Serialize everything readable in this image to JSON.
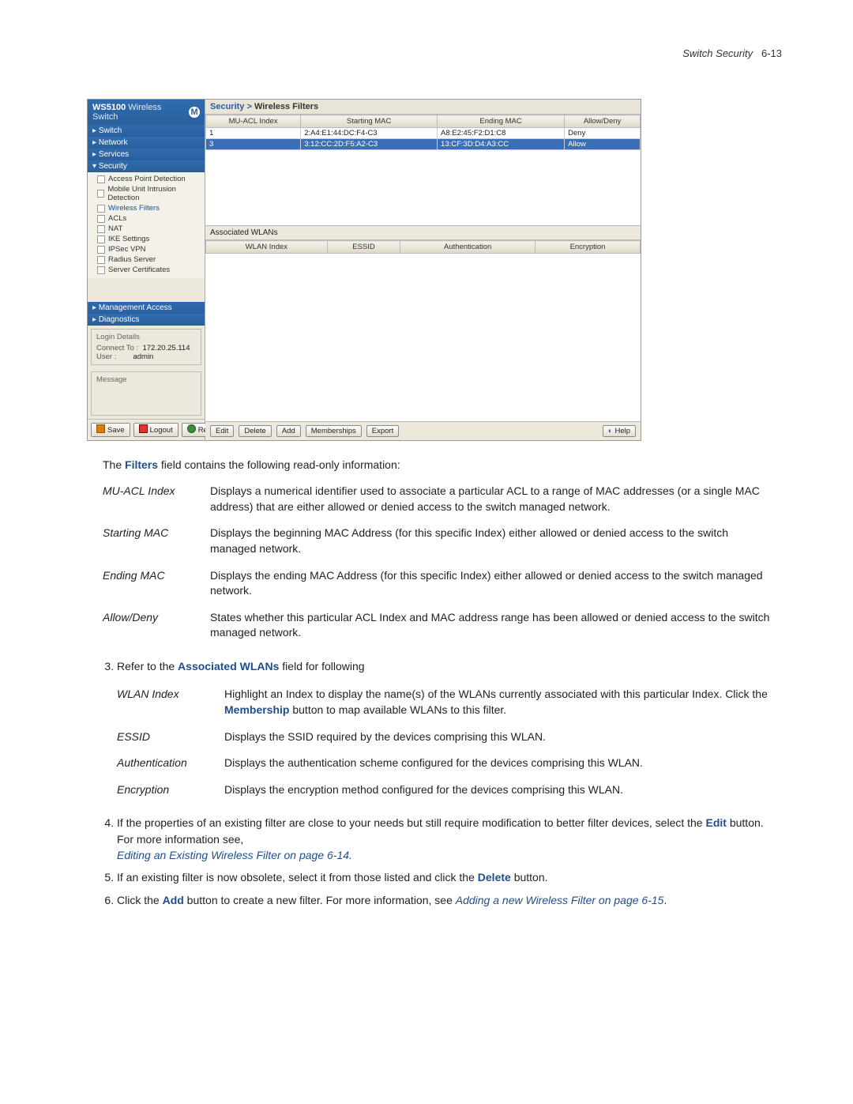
{
  "page_header": {
    "title_italic": "Switch Security",
    "page_no": "6-13"
  },
  "app": {
    "brand": "WS5100",
    "brand_sub": "Wireless Switch",
    "breadcrumb_prefix": "Security >",
    "breadcrumb_current": "Wireless Filters",
    "nav": {
      "switch": "Switch",
      "network": "Network",
      "services": "Services",
      "security": "Security",
      "items": [
        "Access Point Detection",
        "Mobile Unit Intrusion Detection",
        "Wireless Filters",
        "ACLs",
        "NAT",
        "IKE Settings",
        "IPSec VPN",
        "Radius Server",
        "Server Certificates"
      ],
      "mgmt": "Management Access",
      "diag": "Diagnostics"
    },
    "login": {
      "title": "Login Details",
      "connect_lbl": "Connect To :",
      "connect_val": "172.20.25.114",
      "user_lbl": "User :",
      "user_val": "admin"
    },
    "message_title": "Message",
    "sidebar_buttons": {
      "save": "Save",
      "logout": "Logout",
      "refresh": "Refresh"
    },
    "filters_table": {
      "headers": [
        "MU-ACL Index",
        "Starting MAC",
        "Ending MAC",
        "Allow/Deny"
      ],
      "rows": [
        {
          "idx": "1",
          "start": "2:A4:E1:44:DC:F4-C3",
          "end": "A8:E2:45:F2:D1:C8",
          "ad": "Deny",
          "selected": false
        },
        {
          "idx": "3",
          "start": "3:12:CC:2D:F5:A2-C3",
          "end": "13:CF:3D:D4:A3:CC",
          "ad": "Allow",
          "selected": true
        }
      ]
    },
    "assoc_label": "Associated WLANs",
    "assoc_headers": [
      "WLAN Index",
      "ESSID",
      "Authentication",
      "Encryption"
    ],
    "main_buttons": {
      "edit": "Edit",
      "delete": "Delete",
      "add": "Add",
      "memberships": "Memberships",
      "export": "Export",
      "help": "Help"
    }
  },
  "doc": {
    "intro_pre": "The ",
    "intro_bold": "Filters",
    "intro_post": " field contains the following read-only information:",
    "filters_defs": [
      {
        "term": "MU-ACL Index",
        "def": "Displays a numerical identifier used to associate a particular ACL to a range of MAC addresses (or a single MAC address) that are either allowed or denied access to the switch managed network."
      },
      {
        "term": "Starting MAC",
        "def": "Displays the beginning MAC Address (for this specific Index) either allowed or denied access to the switch managed network."
      },
      {
        "term": "Ending MAC",
        "def": "Displays the ending MAC Address (for this specific Index) either allowed or denied access to the switch managed network."
      },
      {
        "term": "Allow/Deny",
        "def": "States whether this particular ACL Index and MAC address range has been allowed or denied access to the switch managed network."
      }
    ],
    "step3": {
      "pre": "Refer to the ",
      "bold": "Associated WLANs",
      "post": " field for following"
    },
    "wlan_defs": [
      {
        "term": "WLAN Index",
        "def_pre": "Highlight an Index to display the name(s) of the WLANs currently associated with this particular Index. Click the ",
        "def_bold": "Membership",
        "def_post": " button to map available WLANs to this filter."
      },
      {
        "term": "ESSID",
        "def": "Displays the SSID required by the devices comprising this WLAN."
      },
      {
        "term": "Authentication",
        "def": "Displays the authentication scheme configured for the devices comprising this WLAN."
      },
      {
        "term": "Encryption",
        "def": "Displays the encryption method configured for the devices comprising this WLAN."
      }
    ],
    "step4": {
      "line1_pre": "If the properties of an existing filter are close to your needs but still require modification to better filter devices, select the ",
      "line1_bold": "Edit",
      "line1_post": " button. For more information see,",
      "link": "Editing an Existing Wireless Filter on page 6-14."
    },
    "step5": {
      "pre": "If an existing filter is now obsolete, select it from those listed and click the ",
      "bold": "Delete",
      "post": " button."
    },
    "step6": {
      "pre": "Click the ",
      "bold": "Add",
      "mid": " button to create a new filter. For more information, see ",
      "link": "Adding a new Wireless Filter on page 6-15",
      "post": "."
    }
  }
}
